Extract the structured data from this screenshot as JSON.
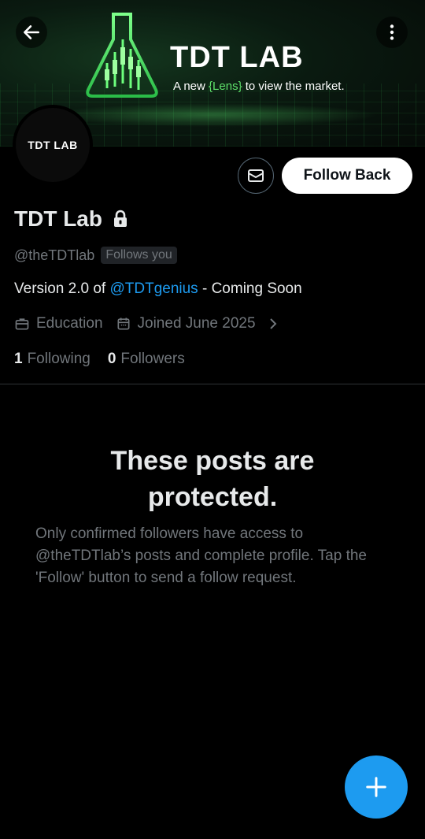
{
  "banner": {
    "title": "TDT LAB",
    "tagline_prefix": "A new ",
    "tagline_lens": "{Lens}",
    "tagline_suffix": " to view the market.",
    "accent": "#5ee06a"
  },
  "avatar": {
    "text": "TDT LAB"
  },
  "actions": {
    "follow_label": "Follow Back"
  },
  "profile": {
    "display_name": "TDT Lab",
    "handle": "@theTDTlab",
    "follows_you": "Follows you",
    "bio_prefix": "Version 2.0 of ",
    "bio_mention": "@TDTgenius",
    "bio_suffix": " - Coming Soon",
    "category": "Education",
    "joined": "Joined June 2025",
    "following_count": "1",
    "following_label": "Following",
    "followers_count": "0",
    "followers_label": "Followers"
  },
  "protected": {
    "title": "These posts are protected.",
    "body": "Only confirmed followers have access to @theTDTlab’s posts and complete profile. Tap the 'Follow' button to send a follow request."
  },
  "colors": {
    "link": "#1d9bf0",
    "muted": "#71767b",
    "fab": "#1d9bf0"
  }
}
